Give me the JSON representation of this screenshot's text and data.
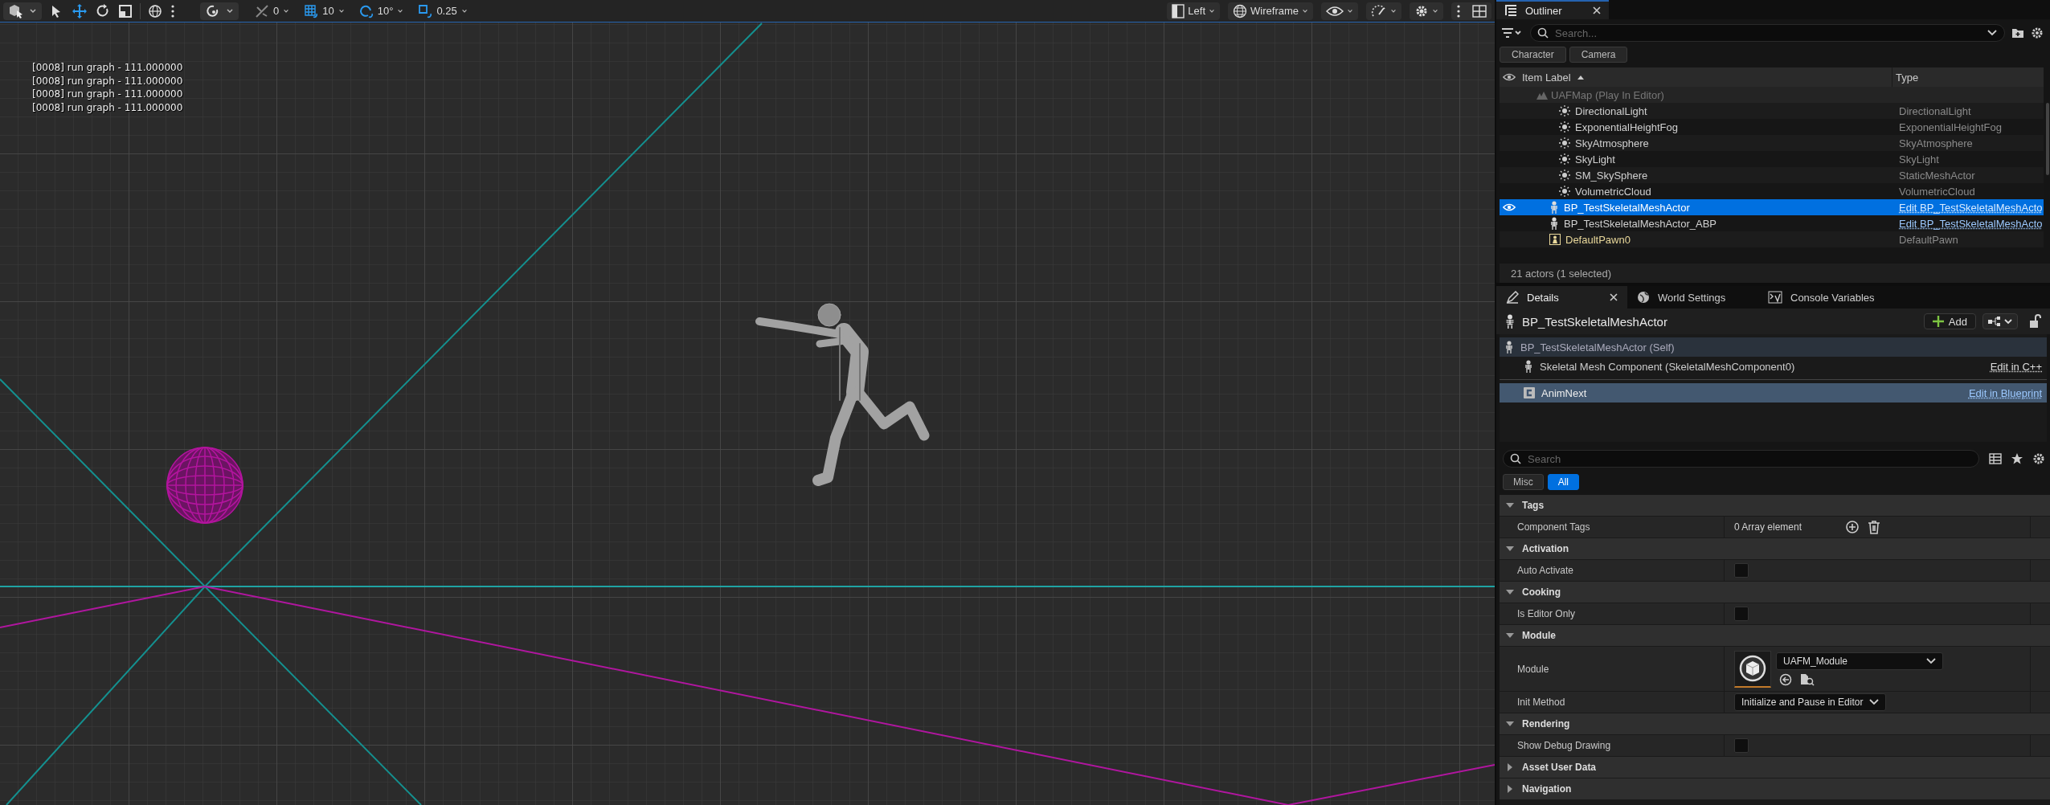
{
  "viewport": {
    "toolbar": {
      "transform_tools": [
        {
          "kind": "select",
          "selected": false
        },
        {
          "kind": "move",
          "selected": true
        },
        {
          "kind": "rotate",
          "selected": false
        },
        {
          "kind": "scale",
          "selected": false
        }
      ],
      "snaps": [
        {
          "kind": "surface",
          "value": "0",
          "on": false
        },
        {
          "kind": "grid",
          "value": "10",
          "on": true
        },
        {
          "kind": "rotation",
          "value": "10°",
          "on": true
        },
        {
          "kind": "scale",
          "value": "0.25",
          "on": true
        }
      ],
      "view_type": "Left",
      "view_mode": "Wireframe"
    },
    "log_lines": [
      "[0008] run graph - 111.000000",
      "[0008] run graph - 111.000000",
      "[0008] run graph - 111.000000",
      "[0008] run graph - 111.000000"
    ]
  },
  "outliner": {
    "tab": "Outliner",
    "search": {
      "placeholder": "Search..."
    },
    "filters": [
      "Character",
      "Camera"
    ],
    "columns": [
      "Item Label",
      "Type"
    ],
    "world_row": "UAFMap (Play In Editor)",
    "rows": [
      {
        "label": "DirectionalLight",
        "type": "DirectionalLight",
        "kind": "lighting",
        "type_link": false,
        "selected": false
      },
      {
        "label": "ExponentialHeightFog",
        "type": "ExponentialHeightFog",
        "kind": "lighting",
        "type_link": false,
        "selected": false
      },
      {
        "label": "SkyAtmosphere",
        "type": "SkyAtmosphere",
        "kind": "lighting",
        "type_link": false,
        "selected": false
      },
      {
        "label": "SkyLight",
        "type": "SkyLight",
        "kind": "lighting",
        "type_link": false,
        "selected": false
      },
      {
        "label": "SM_SkySphere",
        "type": "StaticMeshActor",
        "kind": "lighting",
        "type_link": false,
        "selected": false
      },
      {
        "label": "VolumetricCloud",
        "type": "VolumetricCloud",
        "kind": "lighting",
        "type_link": false,
        "selected": false
      },
      {
        "label": "BP_TestSkeletalMeshActor",
        "type": "Edit BP_TestSkeletalMeshActo",
        "kind": "skeletal",
        "type_link": true,
        "selected": true
      },
      {
        "label": "BP_TestSkeletalMeshActor_ABP",
        "type": "Edit BP_TestSkeletalMeshActo",
        "kind": "skeletal",
        "type_link": true,
        "selected": false
      },
      {
        "label": "DefaultPawn0",
        "type": "DefaultPawn",
        "kind": "pawn",
        "type_link": false,
        "selected": false
      }
    ],
    "status": "21 actors (1 selected)"
  },
  "details": {
    "tabs": [
      {
        "label": "Details",
        "selected": true
      },
      {
        "label": "World Settings",
        "selected": false
      },
      {
        "label": "Console Variables",
        "selected": false
      }
    ],
    "actor": "BP_TestSkeletalMeshActor",
    "add_button": "Add",
    "components": [
      {
        "label": "BP_TestSkeletalMeshActor (Self)",
        "kind": "self",
        "selected": false
      },
      {
        "label": "Skeletal Mesh Component (SkeletalMeshComponent0)",
        "kind": "component",
        "link": "Edit in C++",
        "selected": false
      },
      {
        "label": "AnimNext",
        "kind": "script",
        "link": "Edit in Blueprint",
        "selected": true
      }
    ],
    "search": {
      "placeholder": "Search"
    },
    "filters": [
      {
        "label": "Misc",
        "selected": false
      },
      {
        "label": "All",
        "selected": true
      }
    ],
    "categories": [
      {
        "title": "Tags",
        "expanded": true,
        "properties": [
          {
            "label": "Component Tags",
            "kind": "array",
            "value": "0 Array element"
          }
        ]
      },
      {
        "title": "Activation",
        "expanded": true,
        "properties": [
          {
            "label": "Auto Activate",
            "kind": "checkbox",
            "checked": false
          }
        ]
      },
      {
        "title": "Cooking",
        "expanded": true,
        "properties": [
          {
            "label": "Is Editor Only",
            "kind": "checkbox",
            "checked": false
          }
        ]
      },
      {
        "title": "Module",
        "expanded": true,
        "properties": [
          {
            "label": "Module",
            "kind": "asset",
            "value": "UAFM_Module"
          },
          {
            "label": "Init Method",
            "kind": "combo",
            "value": "Initialize and Pause in Editor"
          }
        ]
      },
      {
        "title": "Rendering",
        "expanded": true,
        "properties": [
          {
            "label": "Show Debug Drawing",
            "kind": "checkbox",
            "checked": false
          }
        ]
      },
      {
        "title": "Asset User Data",
        "expanded": false
      },
      {
        "title": "Navigation",
        "expanded": false
      }
    ]
  }
}
